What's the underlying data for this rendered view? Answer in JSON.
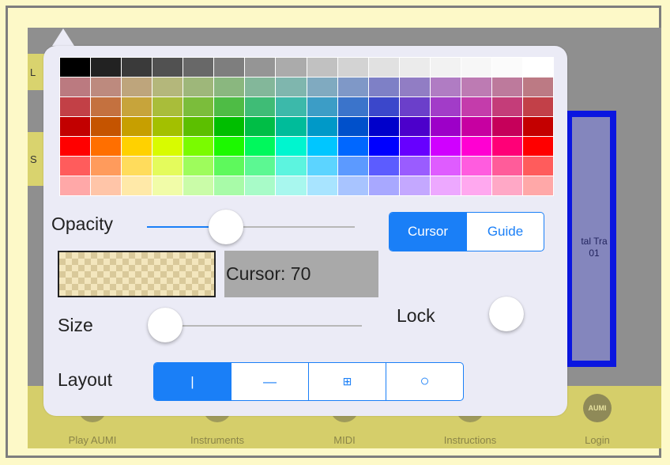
{
  "side_tabs": [
    "L",
    "S"
  ],
  "track": {
    "label_line1": "tal Tra",
    "label_line2": "01"
  },
  "tabbar": {
    "items": [
      {
        "label": "Play AUMI",
        "icon": "play-aumi-icon"
      },
      {
        "label": "Instruments",
        "icon": "instruments-icon"
      },
      {
        "label": "MIDI",
        "icon": "midi-icon"
      },
      {
        "label": "Instructions",
        "icon": "instructions-icon"
      },
      {
        "label": "Login",
        "icon": "aumi-logo-icon",
        "badge": "AUMI"
      }
    ]
  },
  "palette": {
    "rows": [
      [
        "#000000",
        "#222222",
        "#3a3a3a",
        "#515151",
        "#686868",
        "#7e7e7e",
        "#959595",
        "#ababab",
        "#c1c1c1",
        "#d3d3d3",
        "#e1e1e1",
        "#ebebeb",
        "#f2f2f2",
        "#f7f7f7",
        "#fbfbfb",
        "#ffffff"
      ],
      [
        "#bb7a80",
        "#bd8a7e",
        "#bea57c",
        "#b4b77b",
        "#9eb77a",
        "#8ab77f",
        "#83b79a",
        "#7fb6ae",
        "#80aac0",
        "#7f98c7",
        "#7e80c6",
        "#917dc4",
        "#b07cc3",
        "#bd7bb3",
        "#bd7a9c",
        "#bc7a84"
      ],
      [
        "#c24046",
        "#c4713f",
        "#c7a43b",
        "#a9bd3a",
        "#7bbd3b",
        "#4ebc45",
        "#3fbc76",
        "#3cb9aa",
        "#3c9dc6",
        "#3b74cb",
        "#3b47cb",
        "#6b3fca",
        "#a23cc8",
        "#c43cab",
        "#c43d79",
        "#c24048"
      ],
      [
        "#c20000",
        "#c55400",
        "#c79f00",
        "#a3c000",
        "#5cbf00",
        "#00be00",
        "#00be46",
        "#00bc9a",
        "#0099c8",
        "#0050cb",
        "#0000cb",
        "#4c00cb",
        "#9d00c8",
        "#c700a1",
        "#c6005a",
        "#c40000"
      ],
      [
        "#ff0000",
        "#ff6f00",
        "#ffd100",
        "#d8fb00",
        "#7afb00",
        "#1cf900",
        "#00f85c",
        "#00f5cf",
        "#00c6ff",
        "#0067ff",
        "#0000ff",
        "#6700ff",
        "#d000ff",
        "#ff00d2",
        "#ff0077",
        "#ff0000"
      ],
      [
        "#ff5c5c",
        "#ff9b5c",
        "#ffdc5c",
        "#e4fb5c",
        "#9efc5c",
        "#5ef95c",
        "#5cf892",
        "#5cf4df",
        "#5cd4ff",
        "#5c9aff",
        "#5c5cff",
        "#9a5cff",
        "#df5cff",
        "#ff5cdf",
        "#ff5c9a",
        "#ff5c5c"
      ],
      [
        "#ffa8a8",
        "#ffc5a8",
        "#ffe9a8",
        "#f1fca8",
        "#cafca8",
        "#a8fba8",
        "#a8fbc8",
        "#a8f7ee",
        "#a8e4ff",
        "#a8c4ff",
        "#a8a8ff",
        "#c4a8ff",
        "#eda8ff",
        "#ffa8ef",
        "#ffa8c6",
        "#ffa8a8"
      ]
    ]
  },
  "opacity": {
    "label": "Opacity",
    "value": 0.38
  },
  "mode_segment": {
    "options": [
      "Cursor",
      "Guide"
    ],
    "selected": "Cursor"
  },
  "readout": {
    "text": "Cursor: 70"
  },
  "size": {
    "label": "Size",
    "value": 0.0
  },
  "lock": {
    "label": "Lock"
  },
  "layout": {
    "label": "Layout",
    "options": [
      {
        "glyph": "|",
        "icon": "vertical-line-icon"
      },
      {
        "glyph": "—",
        "icon": "horizontal-line-icon"
      },
      {
        "glyph": "⊞",
        "icon": "grid-icon"
      },
      {
        "glyph": "○",
        "icon": "circle-icon"
      }
    ],
    "selected_index": 0
  },
  "colors": {
    "accent": "#1a7ff7",
    "tab_bg": "#d5ce6a",
    "track_border": "#0a16e0"
  }
}
